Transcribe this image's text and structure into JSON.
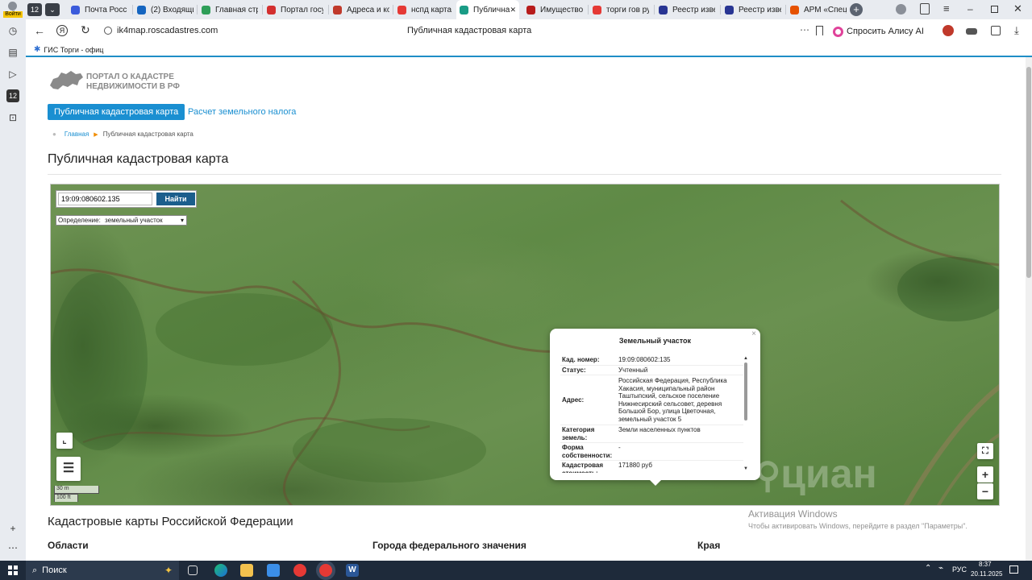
{
  "browser": {
    "tab_count": "12",
    "tabs": [
      {
        "label": "Почта Росси",
        "color": "#3b5bdb"
      },
      {
        "label": "(2) Входящи",
        "color": "#1565c0"
      },
      {
        "label": "Главная стр",
        "color": "#2e9e58"
      },
      {
        "label": "Портал госу",
        "color": "#d32f2f"
      },
      {
        "label": "Адреса и ко",
        "color": "#c0392b"
      },
      {
        "label": "нспд карта п",
        "color": "#e53935"
      },
      {
        "label": "Публична",
        "color": "#1a9c86"
      },
      {
        "label": "Имущество",
        "color": "#b71c1c"
      },
      {
        "label": "торги гов ру",
        "color": "#e53935"
      },
      {
        "label": "Реестр изве",
        "color": "#283593"
      },
      {
        "label": "Реестр изве",
        "color": "#283593"
      },
      {
        "label": "АРМ «Специ",
        "color": "#e65100"
      }
    ],
    "login_label": "Войти",
    "url": "ik4map.roscadastres.com",
    "page_title": "Публичная кадастровая карта",
    "alice_label": "Спросить Алису AI",
    "bookmark": "ГИС Торги - офиц"
  },
  "site": {
    "logo_line1": "ПОРТАЛ О КАДАСТРЕ",
    "logo_line2": "НЕДВИЖИМОСТИ В РФ",
    "nav": [
      {
        "label": "Публичная кадастровая карта"
      },
      {
        "label": "Расчет земельного налога"
      }
    ],
    "breadcrumb_home": "Главная",
    "breadcrumb_current": "Публичная кадастровая карта",
    "heading": "Публичная кадастровая карта"
  },
  "map": {
    "search_value": "19:09:080602.135",
    "search_button": "Найти",
    "definition_label": "Определение:",
    "definition_value": "земельный участок",
    "scale_m": "30 m",
    "scale_ft": "100 ft",
    "watermark": "циан",
    "popup": {
      "title": "Земельный участок",
      "rows": [
        {
          "key": "Кад. номер:",
          "value": "19:09:080602:135"
        },
        {
          "key": "Статус:",
          "value": "Учтенный"
        },
        {
          "key": "Адрес:",
          "value": "Российская Федерация, Республика Хакасия, муниципальный район Таштыпский, сельское поселение Нижнесирский сельсовет, деревня Большой Бор, улица Цветочная, земельный участок 5"
        },
        {
          "key": "Категория земель:",
          "value": "Земли населенных пунктов"
        },
        {
          "key": "Форма собственности:",
          "value": "-"
        },
        {
          "key": "Кадастровая стоимость:",
          "value": "171880 руб"
        }
      ]
    }
  },
  "below": {
    "heading": "Кадастровые карты Российской Федерации",
    "col1": "Области",
    "col2": "Города федерального значения",
    "col3": "Края"
  },
  "activation": {
    "title": "Активация Windows",
    "text": "Чтобы активировать Windows, перейдите в раздел \"Параметры\"."
  },
  "taskbar": {
    "search": "Поиск",
    "lang": "РУС",
    "time": "8:37",
    "date": "20.11.2025"
  }
}
